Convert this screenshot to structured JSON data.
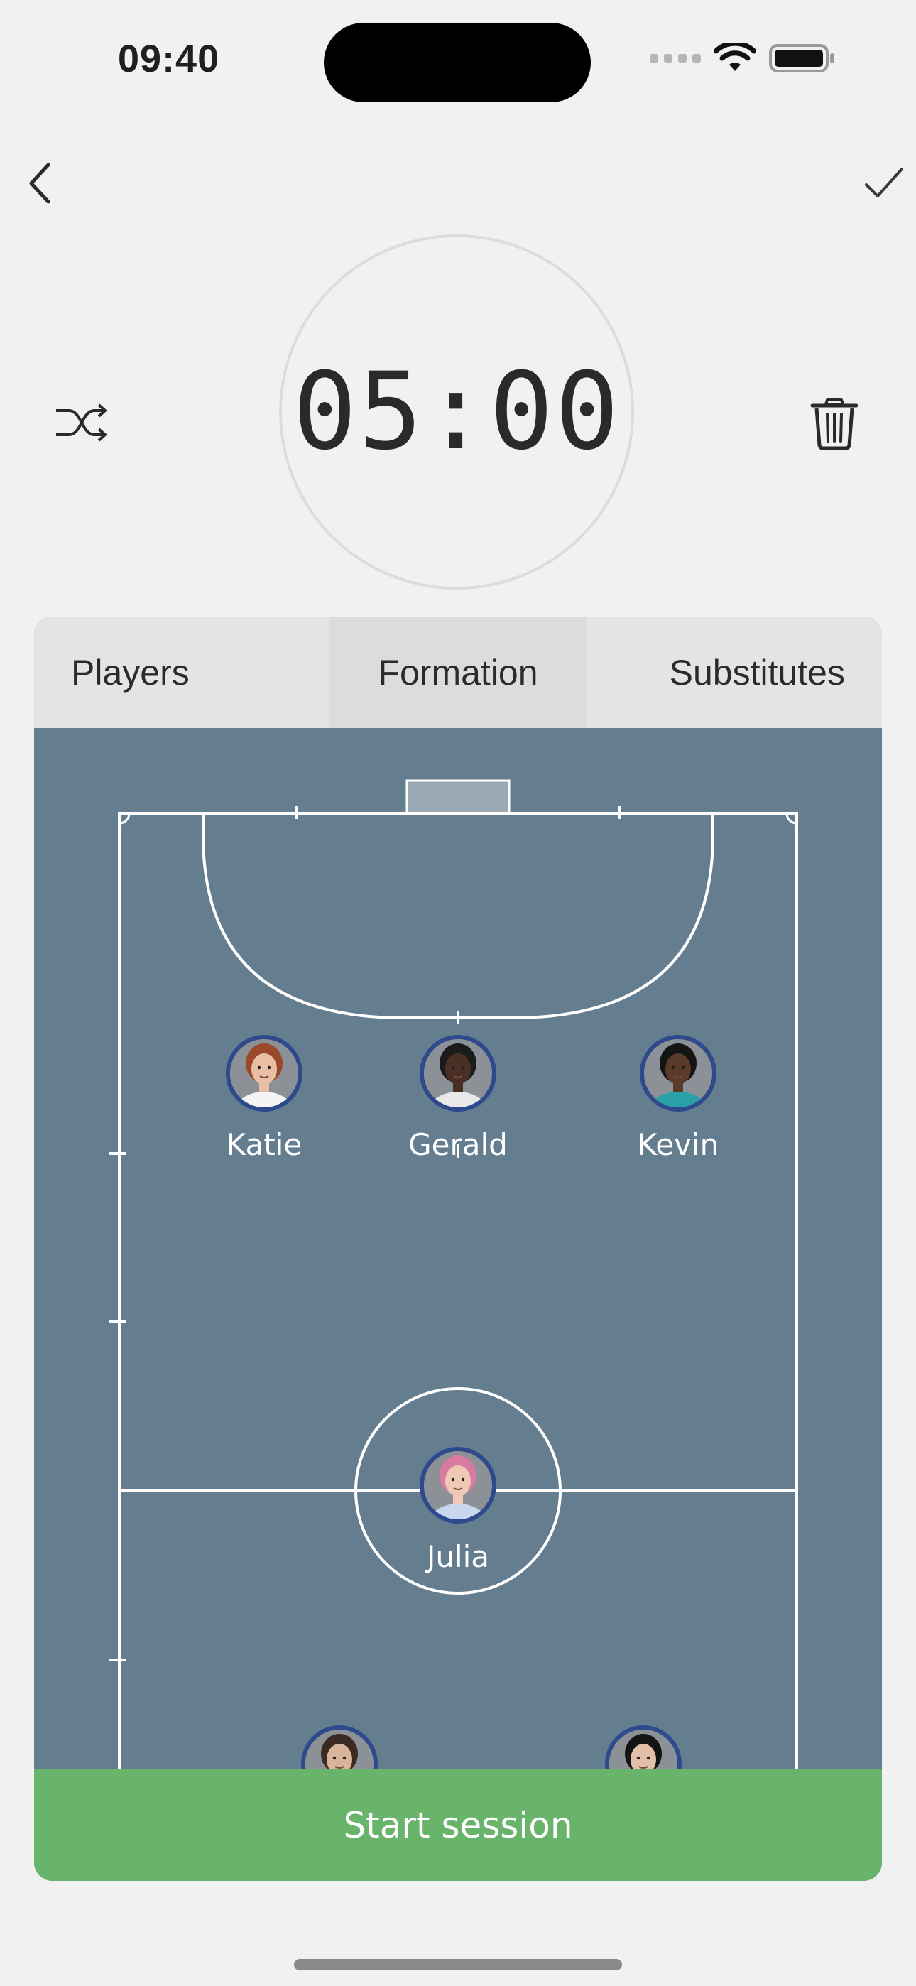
{
  "status_bar": {
    "time": "09:40"
  },
  "timer": {
    "display": "05:00"
  },
  "tabs": [
    {
      "label": "Players",
      "selected": false
    },
    {
      "label": "Formation",
      "selected": true
    },
    {
      "label": "Substitutes",
      "selected": false
    }
  ],
  "players": [
    {
      "name": "Katie",
      "hair": "#9a4a2a",
      "skin": "#e8bfa4",
      "shirt": "#f4f4f4"
    },
    {
      "name": "Gerald",
      "hair": "#1b1b1b",
      "skin": "#4a3024",
      "shirt": "#e9e9e9"
    },
    {
      "name": "Kevin",
      "hair": "#141414",
      "skin": "#5a3a28",
      "shirt": "#2aa0a8"
    },
    {
      "name": "Julia",
      "hair": "#d97aa0",
      "skin": "#f0c9b6",
      "shirt": "#c8d6ee"
    },
    {
      "name": "",
      "hair": "#3a2a22",
      "skin": "#d9b39a",
      "shirt": "#eeeeee"
    },
    {
      "name": "",
      "hair": "#141414",
      "skin": "#e2bfa6",
      "shirt": "#eeeeee"
    }
  ],
  "actions": {
    "start_label": "Start session"
  },
  "colors": {
    "pitch": "#647e90",
    "start": "#68b46a",
    "avatar_ring": "#2e4a8c"
  },
  "icons": [
    "back-chevron-icon",
    "checkmark-icon",
    "shuffle-icon",
    "trash-icon",
    "wifi-icon",
    "battery-icon",
    "signal-icon"
  ]
}
